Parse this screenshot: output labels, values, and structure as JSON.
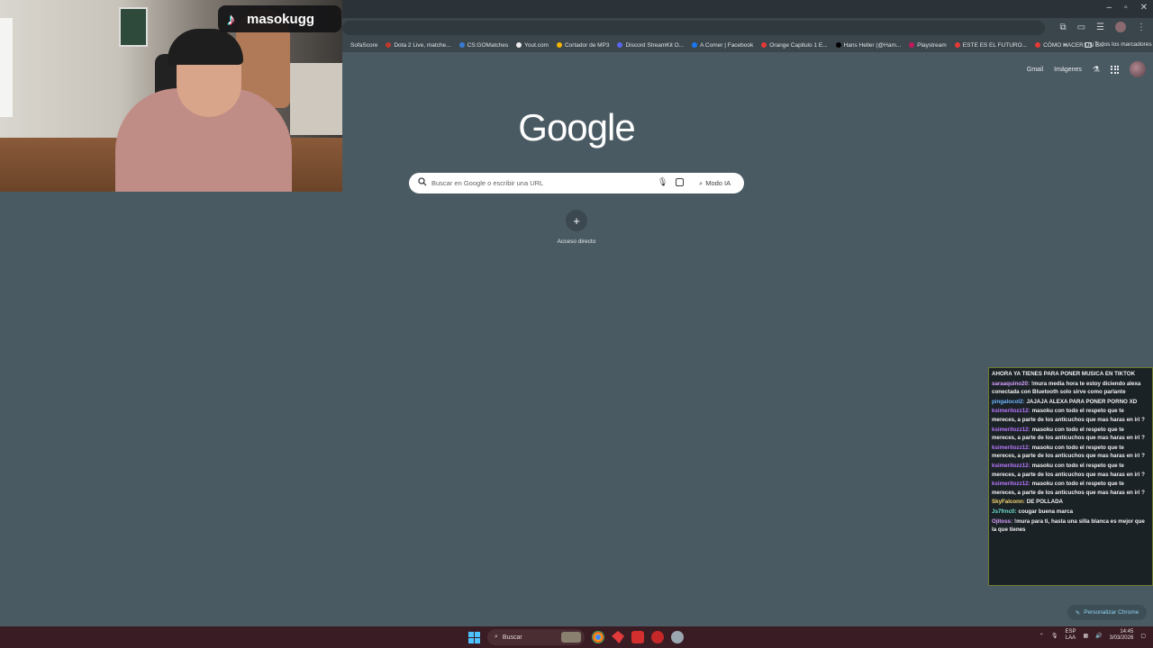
{
  "window": {
    "minimize": "–",
    "restore": "▫",
    "close": "✕"
  },
  "bookmarks": [
    {
      "label": "SofaScore",
      "color": "#3b464c"
    },
    {
      "label": "Dota 2 Live, matche...",
      "color": "#c0392b"
    },
    {
      "label": "CS:GOMatches",
      "color": "#3a7bd5"
    },
    {
      "label": "Yout.com",
      "color": "#eeeeee"
    },
    {
      "label": "Cortador de MP3",
      "color": "#f4b400"
    },
    {
      "label": "Discord StreamKit O...",
      "color": "#5865f2"
    },
    {
      "label": "A Comer | Facebook",
      "color": "#1877f2"
    },
    {
      "label": "Orange Capitulo 1 E...",
      "color": "#e53935"
    },
    {
      "label": "Hans Heller (@Ham...",
      "color": "#000000"
    },
    {
      "label": "Playstream",
      "color": "#c2185b"
    },
    {
      "label": "ESTE ES EL FUTURO...",
      "color": "#e53935"
    },
    {
      "label": "CÓMO HACER UN E...",
      "color": "#e53935"
    }
  ],
  "bookmarks_more": "»",
  "bookmarks_all": "Todos los marcadores",
  "tiktok": {
    "name": "masokugg"
  },
  "google_top": {
    "gmail": "Gmail",
    "images": "Imágenes"
  },
  "logo": "Google",
  "search": {
    "placeholder": "Buscar en Google o escribir una URL",
    "ai_mode": "Modo IA"
  },
  "shortcut": {
    "plus": "+",
    "label": "Acceso directo"
  },
  "chat": [
    {
      "user": "",
      "color": "u-green",
      "text": "AHORA YA TIENES PARA PONER MUSICA EN TIKTOK"
    },
    {
      "user": "saraaquino20:",
      "color": "u-pink",
      "text": "!mura media hora te estoy diciendo alexa conectada con Bluetooth solo sirve como parlante"
    },
    {
      "user": "pingalocol2:",
      "color": "u-blue",
      "text": "JAJAJA ALEXA PARA PONER PORNO XD"
    },
    {
      "user": "ksimeritozz12:",
      "color": "u-purple",
      "text": "masoku con todo el respeto que te mereces, a parte de los anticuchos que mas haras en iri ?"
    },
    {
      "user": "ksimeritozz12:",
      "color": "u-purple",
      "text": "masoku con todo el respeto que te mereces, a parte de los anticuchos que mas haras en iri ?"
    },
    {
      "user": "ksimeritozz12:",
      "color": "u-purple",
      "text": "masoku con todo el respeto que te mereces, a parte de los anticuchos que mas haras en iri ?"
    },
    {
      "user": "ksimeritozz12:",
      "color": "u-purple",
      "text": "masoku con todo el respeto que te mereces, a parte de los anticuchos que mas haras en iri ?"
    },
    {
      "user": "ksimeritozz12:",
      "color": "u-purple",
      "text": "masoku con todo el respeto que te mereces, a parte de los anticuchos que mas haras en iri ?"
    },
    {
      "user": "SkyFalconn:",
      "color": "u-yellow",
      "text": "DE POLLADA"
    },
    {
      "user": "Js7frnc0:",
      "color": "u-cyan",
      "text": "cougar buena marca"
    },
    {
      "user": "Ojitoss:",
      "color": "u-pink",
      "text": "!mura para ti, hasta una silla blanca es mejor que la que tienes"
    }
  ],
  "customize": "Personalizar Chrome",
  "taskbar": {
    "search": "Buscar",
    "lang_top": "ESP",
    "lang_bottom": "LAA",
    "time": "14:45",
    "date": "3/03/2026"
  }
}
